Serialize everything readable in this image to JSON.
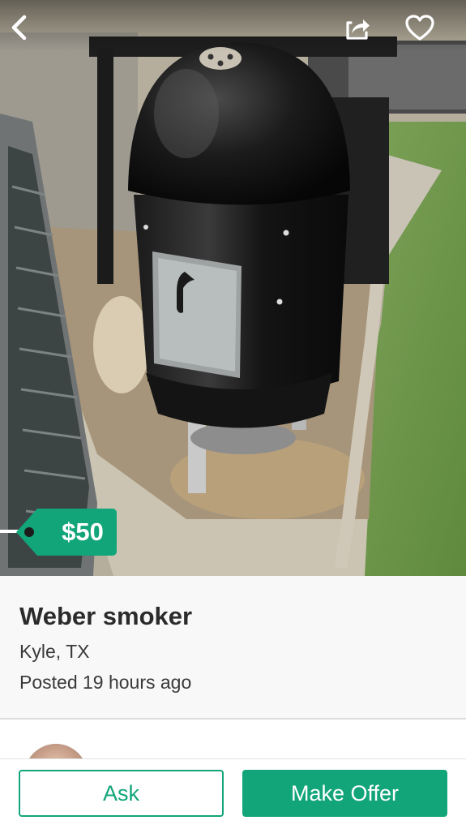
{
  "listing": {
    "price": "$50",
    "title": "Weber smoker",
    "location": "Kyle, TX",
    "posted": "Posted 19 hours ago"
  },
  "actions": {
    "ask_label": "Ask",
    "offer_label": "Make Offer"
  },
  "icons": {
    "back": "chevron-left-icon",
    "share": "share-icon",
    "favorite": "heart-icon"
  },
  "colors": {
    "accent": "#12a57a",
    "details_background": "#f8f8f8",
    "text": "#2b2b2b"
  }
}
